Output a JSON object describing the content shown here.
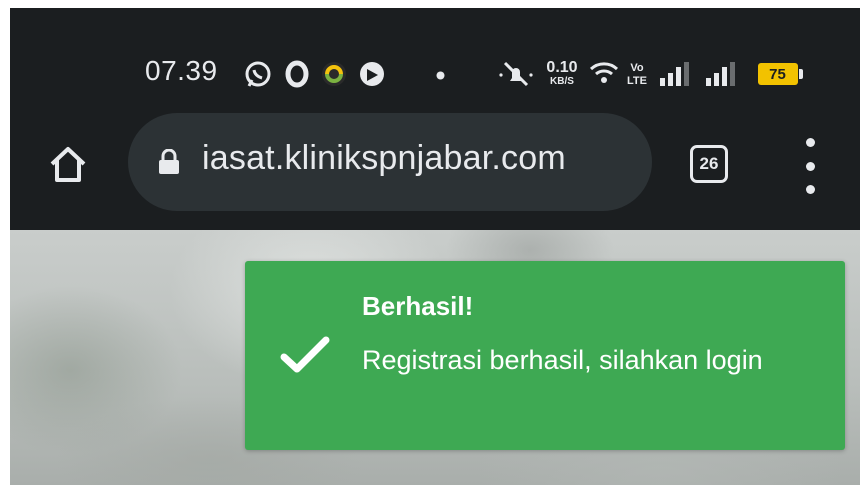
{
  "status_bar": {
    "time": "07.39",
    "network_speed_value": "0.10",
    "network_speed_unit": "KB/S",
    "volte_label_top": "Vo",
    "volte_label_bottom": "LTE",
    "battery_level": "75",
    "battery_color": "#f2c200",
    "icons": [
      "whatsapp-icon",
      "opera-icon",
      "notification-icon",
      "app-icon",
      "dot-icon",
      "mute-icon",
      "wifi-icon",
      "signal-icon",
      "signal-icon",
      "battery-icon"
    ]
  },
  "browser": {
    "url": "iasat.klinikspnjabar.com",
    "tab_count": "26"
  },
  "toast": {
    "title": "Berhasil!",
    "message": "Registrasi berhasil, silahkan login",
    "color": "#3ea953"
  }
}
